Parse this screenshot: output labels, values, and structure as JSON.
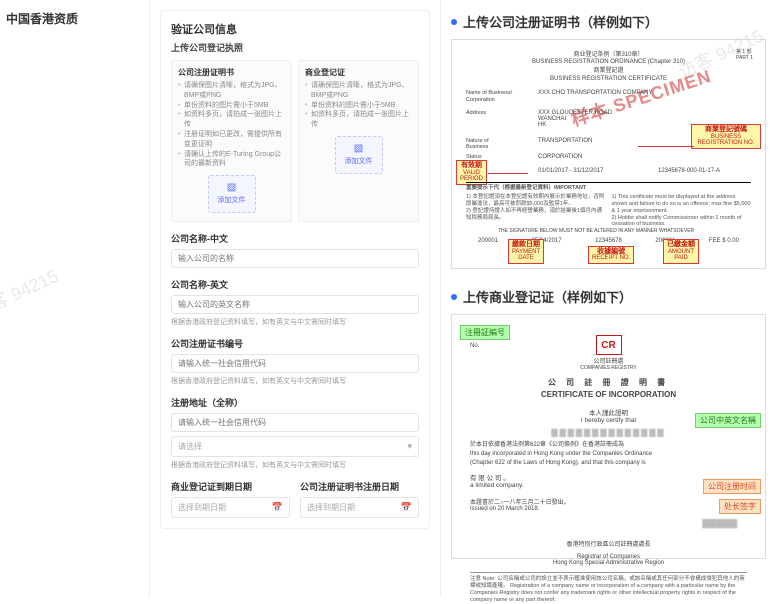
{
  "left": {
    "title": "中国香港资质"
  },
  "form": {
    "section_title": "验证公司信息",
    "sub_title": "上传公司登记执照",
    "upload1": {
      "label": "公司注册证明书",
      "tips": [
        "请确保图片清晰，格式为JPG、BMP或PNG",
        "单份资料的图片需小于5MB",
        "如资料多页，请拍成一张图片上传",
        "注册证明如已更改，需提供所有变更证明",
        "请确认上传的E-Turing Group公司的最新资料"
      ],
      "btn": "添加文件"
    },
    "upload2": {
      "label": "商业登记证",
      "tips": [
        "请确保图片清晰，格式为JPG、BMP或PNG",
        "单份资料的图片需小于5MB",
        "如资料多页，请拍成一张图片上传"
      ],
      "btn": "添加文件"
    },
    "name_cn": {
      "label": "公司名称-中文",
      "placeholder": "输入公司的名称"
    },
    "name_en": {
      "label": "公司名称-英文",
      "placeholder": "输入公司的英文名称",
      "help": "根据香港政府登记资料填写，如有英文与中文需同时填写"
    },
    "cr_no": {
      "label": "公司注册证书编号",
      "placeholder": "请输入统一社会信用代码",
      "help": "根据香港政府登记资料填写，如有英文与中文需同时填写"
    },
    "address": {
      "label": "注册地址（全称）",
      "placeholder": "请输入统一社会信用代码",
      "help": "根据香港政府登记资料填写，如有英文与中文需同时填写",
      "icon_placeholder": "请选择"
    },
    "bri_expiry": {
      "label": "商业登记证到期日期",
      "placeholder": "选择到期日期"
    },
    "coi_issue": {
      "label": "公司注册证明书注册日期",
      "placeholder": "选择到期日期"
    }
  },
  "right": {
    "header1": "上传公司注册证明书（样例如下）",
    "header2": "上传商业登记证（样例如下）",
    "sample1": {
      "specimen": "样本  SPECIMEN",
      "title_cn": "商业登记条例（第310章）",
      "title_en": "BUSINESS REGISTRATION ORDINANCE (Chapter 310)",
      "sub_en": "BUSINESS REGISTRATION CERTIFICATE",
      "company": "XXX CHO TRANSPORTATION COMPANY",
      "address": "XXX GLOUCESTER ROAD\nWANCHAI\nHK",
      "biz_nature": "TRANSPORTATION",
      "biz_status": "CORPORATION",
      "tag_valid": {
        "cn": "有效期",
        "en": "VALID\nPERIOD"
      },
      "tag_brn": {
        "cn": "商業登記號碼",
        "en": "BUSINESS\nREGISTRATION NO."
      },
      "tag_pay_date": {
        "cn": "繳款日期",
        "en": "PAYMENT\nDATE"
      },
      "tag_receipt": {
        "cn": "收據編號",
        "en": "RECEIPT NO."
      },
      "tag_amount": {
        "cn": "已繳金額",
        "en": "AMOUNT\nPAID"
      },
      "note_cn": "重要提示下代（根据最新登记資料）IMPORTANT",
      "row_vals": [
        "200001",
        "05/04/2017",
        "12345678",
        "200001",
        "FEE $  0.00"
      ]
    },
    "sample2": {
      "cr_label": "公司註冊處",
      "cr_sub": "COMPANIES REGISTRY",
      "title_cn": "公 司 註 冊 證 明 書",
      "title_en": "CERTIFICATE OF INCORPORATION",
      "certify_cn": "本人謹此證明",
      "certify_en": "I hereby certify that",
      "body1_cn": "於本日依據香港法例第622章《公司條例》在香港註冊成為",
      "body1_en": "this day incorporated in Hong Kong under the Companies Ordinance",
      "body2_en": "(Chapter 622 of the Laws of Hong Kong), and that this company is",
      "body3": "有 限 公 司 。\na  limited  company.",
      "issued_cn": "本證書於二○一八年三月二十日發出。",
      "issued_en": "Issued on  20 March 2018.",
      "registrar_cn": "香港特別行政區公司註冊處處長",
      "registrar_en": "Registrar of Companies\nHong Kong Special Administrative Region",
      "note": "注意 Note:\n公司名稱或公司的設立並不表示獲准使用該公司名稱，或該名稱或其任何部分不會構成侵犯其他人的商標或知識產權。\nRegistration of a company name or incorporation of a company with a particular name by the Companies Registry does not confer any trademark rights or other intellectual property rights in respect of the company name or any part thereof.",
      "lbl_regno": "注冊証編号",
      "lbl_name": "公司中英文名稱",
      "lbl_date": "公司注册时间",
      "lbl_sign": "处长签字"
    }
  },
  "watermark": "访客 94215"
}
